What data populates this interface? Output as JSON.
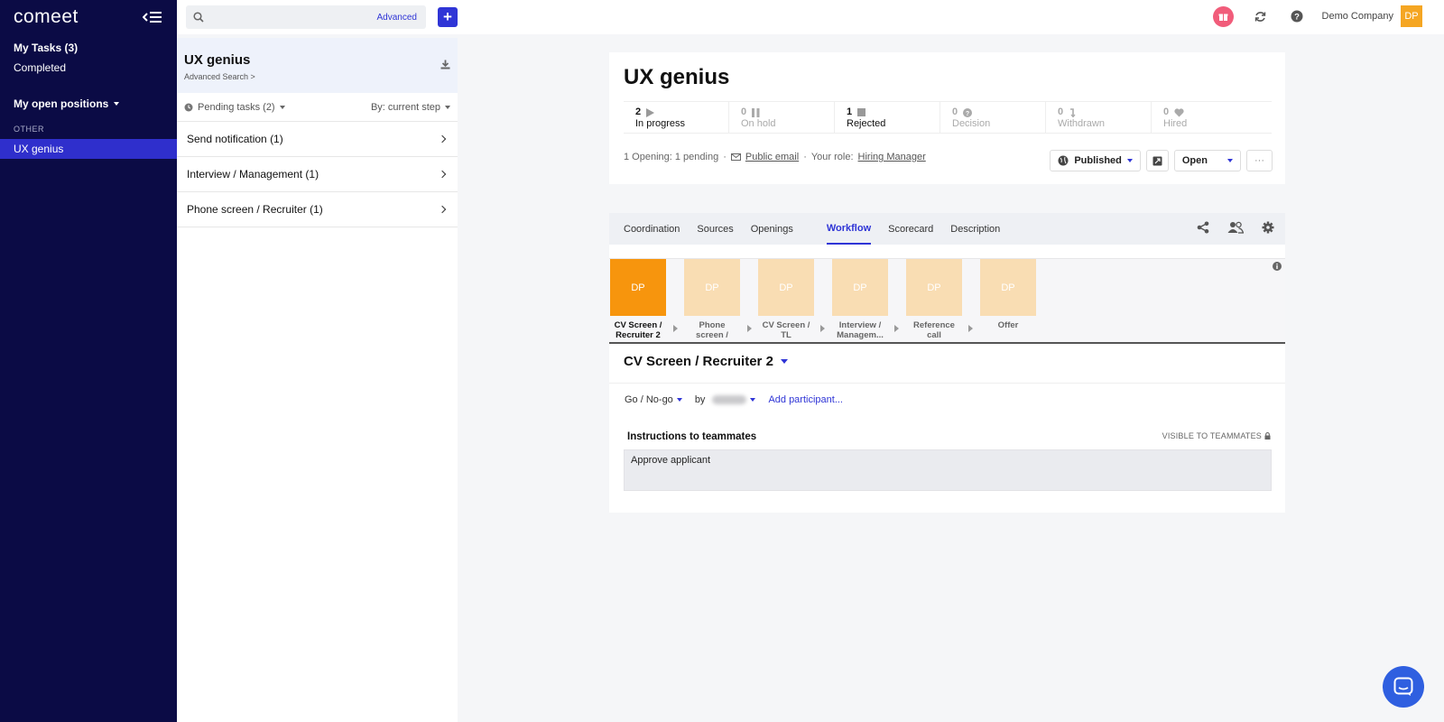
{
  "sidebar": {
    "logo": "comeet",
    "my_tasks": "My Tasks (3)",
    "completed": "Completed",
    "open_positions": "My open positions",
    "other_label": "OTHER",
    "active_item": "UX genius",
    "colors": {
      "bg": "#0b0b45",
      "active": "#2f2fcc"
    }
  },
  "topbar": {
    "search_placeholder": "",
    "advanced": "Advanced",
    "add_button": "+",
    "company": "Demo Company",
    "avatar": "DP"
  },
  "panel": {
    "title": "UX genius",
    "subtitle": "Advanced Search >",
    "filter_left": "Pending tasks (2)",
    "filter_right": "By: current step",
    "tasks": [
      {
        "label": "Send notification (1)"
      },
      {
        "label": "Interview / Management (1)"
      },
      {
        "label": "Phone screen / Recruiter (1)"
      }
    ]
  },
  "position": {
    "title": "UX genius",
    "stats": [
      {
        "count": "2",
        "label": "In progress",
        "icon": "play-icon"
      },
      {
        "count": "0",
        "label": "On hold",
        "icon": "pause-icon"
      },
      {
        "count": "1",
        "label": "Rejected",
        "icon": "stop-icon"
      },
      {
        "count": "0",
        "label": "Decision",
        "icon": "question-icon"
      },
      {
        "count": "0",
        "label": "Withdrawn",
        "icon": "withdraw-icon"
      },
      {
        "count": "0",
        "label": "Hired",
        "icon": "heart-icon"
      }
    ],
    "openings": "1 Opening: 1 pending",
    "dot1": "·",
    "public_email": "Public email",
    "dot2": "·",
    "role_label": "Your role:",
    "role": "Hiring Manager",
    "published": "Published",
    "open": "Open",
    "more": "···"
  },
  "workflow": {
    "tabs": [
      "Coordination",
      "Sources",
      "Openings",
      "Workflow",
      "Scorecard",
      "Description"
    ],
    "active_tab": "Workflow",
    "stages": [
      {
        "initials": "DP",
        "label": "CV Screen / Recruiter 2"
      },
      {
        "initials": "DP",
        "label": "Phone screen /"
      },
      {
        "initials": "DP",
        "label": "CV Screen / TL"
      },
      {
        "initials": "DP",
        "label": "Interview / Managem..."
      },
      {
        "initials": "DP",
        "label": "Reference call"
      },
      {
        "initials": "DP",
        "label": "Offer"
      }
    ],
    "current_stage_title": "CV Screen / Recruiter 2",
    "decision": "Go / No-go",
    "by": "by",
    "add_participant": "Add participant...",
    "instructions_title": "Instructions to teammates",
    "visible_label": "VISIBLE TO TEAMMATES",
    "instructions_text": "Approve applicant",
    "colors": {
      "current": "#f7950d",
      "pending": "#f9ddb3",
      "accent": "#2f35d6"
    }
  }
}
